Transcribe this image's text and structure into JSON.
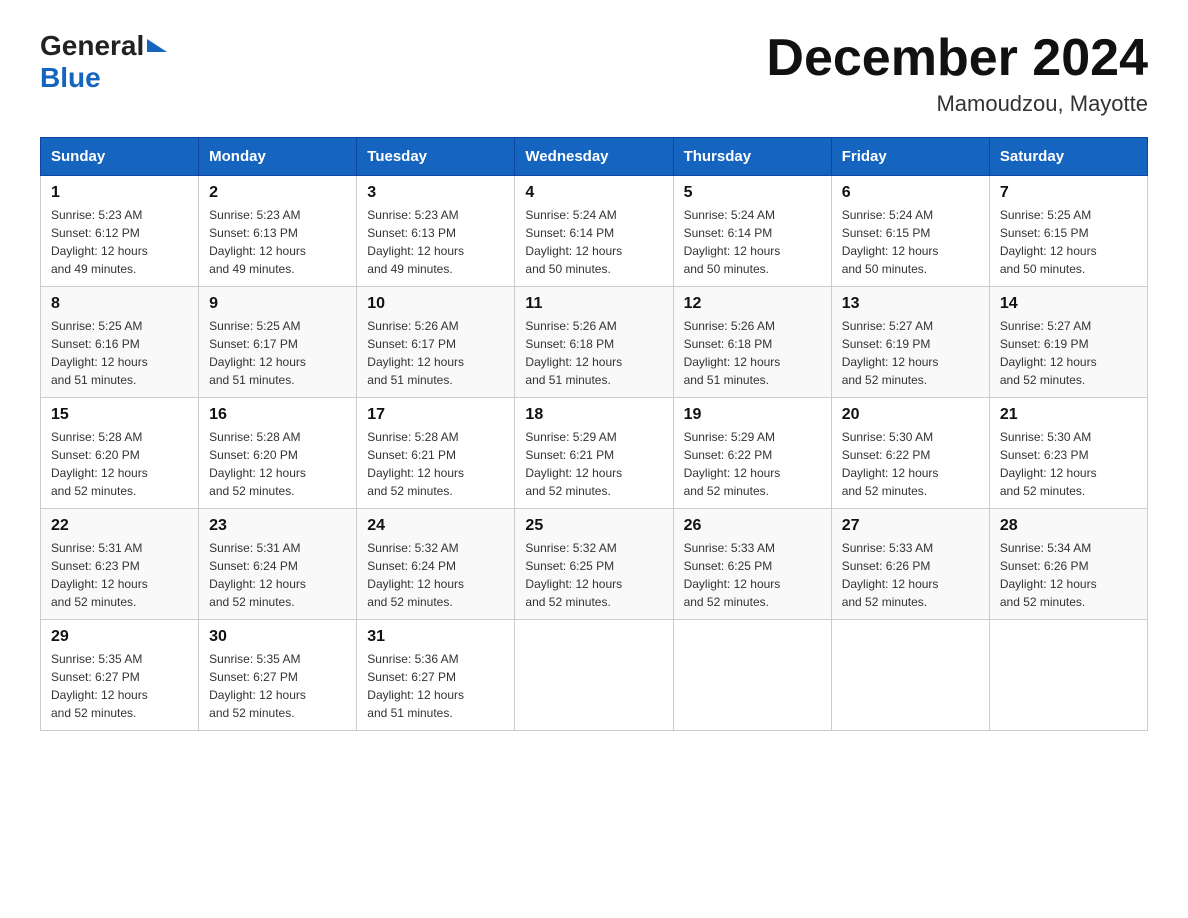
{
  "header": {
    "logo_general": "General",
    "logo_blue": "Blue",
    "month_title": "December 2024",
    "location": "Mamoudzou, Mayotte"
  },
  "days_of_week": [
    "Sunday",
    "Monday",
    "Tuesday",
    "Wednesday",
    "Thursday",
    "Friday",
    "Saturday"
  ],
  "weeks": [
    [
      {
        "day": "1",
        "sunrise": "5:23 AM",
        "sunset": "6:12 PM",
        "daylight": "12 hours and 49 minutes."
      },
      {
        "day": "2",
        "sunrise": "5:23 AM",
        "sunset": "6:13 PM",
        "daylight": "12 hours and 49 minutes."
      },
      {
        "day": "3",
        "sunrise": "5:23 AM",
        "sunset": "6:13 PM",
        "daylight": "12 hours and 49 minutes."
      },
      {
        "day": "4",
        "sunrise": "5:24 AM",
        "sunset": "6:14 PM",
        "daylight": "12 hours and 50 minutes."
      },
      {
        "day": "5",
        "sunrise": "5:24 AM",
        "sunset": "6:14 PM",
        "daylight": "12 hours and 50 minutes."
      },
      {
        "day": "6",
        "sunrise": "5:24 AM",
        "sunset": "6:15 PM",
        "daylight": "12 hours and 50 minutes."
      },
      {
        "day": "7",
        "sunrise": "5:25 AM",
        "sunset": "6:15 PM",
        "daylight": "12 hours and 50 minutes."
      }
    ],
    [
      {
        "day": "8",
        "sunrise": "5:25 AM",
        "sunset": "6:16 PM",
        "daylight": "12 hours and 51 minutes."
      },
      {
        "day": "9",
        "sunrise": "5:25 AM",
        "sunset": "6:17 PM",
        "daylight": "12 hours and 51 minutes."
      },
      {
        "day": "10",
        "sunrise": "5:26 AM",
        "sunset": "6:17 PM",
        "daylight": "12 hours and 51 minutes."
      },
      {
        "day": "11",
        "sunrise": "5:26 AM",
        "sunset": "6:18 PM",
        "daylight": "12 hours and 51 minutes."
      },
      {
        "day": "12",
        "sunrise": "5:26 AM",
        "sunset": "6:18 PM",
        "daylight": "12 hours and 51 minutes."
      },
      {
        "day": "13",
        "sunrise": "5:27 AM",
        "sunset": "6:19 PM",
        "daylight": "12 hours and 52 minutes."
      },
      {
        "day": "14",
        "sunrise": "5:27 AM",
        "sunset": "6:19 PM",
        "daylight": "12 hours and 52 minutes."
      }
    ],
    [
      {
        "day": "15",
        "sunrise": "5:28 AM",
        "sunset": "6:20 PM",
        "daylight": "12 hours and 52 minutes."
      },
      {
        "day": "16",
        "sunrise": "5:28 AM",
        "sunset": "6:20 PM",
        "daylight": "12 hours and 52 minutes."
      },
      {
        "day": "17",
        "sunrise": "5:28 AM",
        "sunset": "6:21 PM",
        "daylight": "12 hours and 52 minutes."
      },
      {
        "day": "18",
        "sunrise": "5:29 AM",
        "sunset": "6:21 PM",
        "daylight": "12 hours and 52 minutes."
      },
      {
        "day": "19",
        "sunrise": "5:29 AM",
        "sunset": "6:22 PM",
        "daylight": "12 hours and 52 minutes."
      },
      {
        "day": "20",
        "sunrise": "5:30 AM",
        "sunset": "6:22 PM",
        "daylight": "12 hours and 52 minutes."
      },
      {
        "day": "21",
        "sunrise": "5:30 AM",
        "sunset": "6:23 PM",
        "daylight": "12 hours and 52 minutes."
      }
    ],
    [
      {
        "day": "22",
        "sunrise": "5:31 AM",
        "sunset": "6:23 PM",
        "daylight": "12 hours and 52 minutes."
      },
      {
        "day": "23",
        "sunrise": "5:31 AM",
        "sunset": "6:24 PM",
        "daylight": "12 hours and 52 minutes."
      },
      {
        "day": "24",
        "sunrise": "5:32 AM",
        "sunset": "6:24 PM",
        "daylight": "12 hours and 52 minutes."
      },
      {
        "day": "25",
        "sunrise": "5:32 AM",
        "sunset": "6:25 PM",
        "daylight": "12 hours and 52 minutes."
      },
      {
        "day": "26",
        "sunrise": "5:33 AM",
        "sunset": "6:25 PM",
        "daylight": "12 hours and 52 minutes."
      },
      {
        "day": "27",
        "sunrise": "5:33 AM",
        "sunset": "6:26 PM",
        "daylight": "12 hours and 52 minutes."
      },
      {
        "day": "28",
        "sunrise": "5:34 AM",
        "sunset": "6:26 PM",
        "daylight": "12 hours and 52 minutes."
      }
    ],
    [
      {
        "day": "29",
        "sunrise": "5:35 AM",
        "sunset": "6:27 PM",
        "daylight": "12 hours and 52 minutes."
      },
      {
        "day": "30",
        "sunrise": "5:35 AM",
        "sunset": "6:27 PM",
        "daylight": "12 hours and 52 minutes."
      },
      {
        "day": "31",
        "sunrise": "5:36 AM",
        "sunset": "6:27 PM",
        "daylight": "12 hours and 51 minutes."
      },
      null,
      null,
      null,
      null
    ]
  ],
  "labels": {
    "sunrise": "Sunrise:",
    "sunset": "Sunset:",
    "daylight": "Daylight:"
  }
}
